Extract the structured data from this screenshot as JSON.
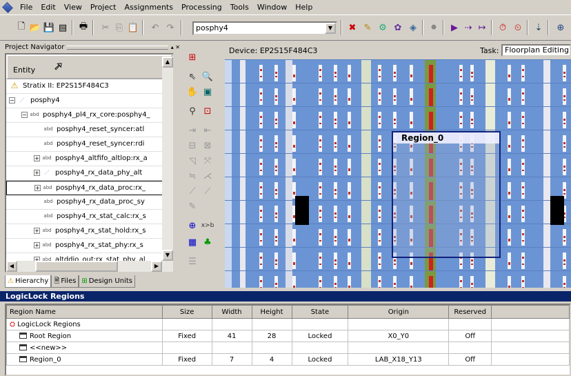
{
  "menu": [
    "File",
    "Edit",
    "View",
    "Project",
    "Assignments",
    "Processing",
    "Tools",
    "Window",
    "Help"
  ],
  "toolbar": {
    "combo_value": "posphy4"
  },
  "navigator": {
    "title": "Project Navigator",
    "column": "Entity",
    "items": [
      {
        "label": "Stratix II: EP2S15F484C3"
      },
      {
        "label": "posphy4"
      },
      {
        "label": "posphy4_pl4_rx_core:posphy4_"
      },
      {
        "label": "posphy4_reset_syncer:atl"
      },
      {
        "label": "posphy4_reset_syncer:rdi"
      },
      {
        "label": "posphy4_altfifo_altlop:rx_a"
      },
      {
        "label": "posphy4_rx_data_phy_alt"
      },
      {
        "label": "posphy4_rx_data_proc:rx_"
      },
      {
        "label": "posphy4_rx_data_proc_sy"
      },
      {
        "label": "posphy4_rx_stat_calc:rx_s"
      },
      {
        "label": "posphy4_rx_stat_hold:rx_s"
      },
      {
        "label": "posphy4_rx_stat_phy:rx_s"
      },
      {
        "label": "altddio_out:rx_stat_phy_al"
      }
    ],
    "tabs": [
      "Hierarchy",
      "Files",
      "Design Units"
    ]
  },
  "floorplan": {
    "device_label": "Device: EP2S15F484C3",
    "task_label": "Task:",
    "task_value": "Floorplan Editing (As",
    "region_label": "Region_0"
  },
  "logiclock": {
    "title": "LogicLock Regions",
    "columns": [
      "Region Name",
      "Size",
      "Width",
      "Height",
      "State",
      "Origin",
      "Reserved"
    ],
    "rows": [
      [
        "LogicLock Regions",
        "",
        "",
        "",
        "",
        "",
        ""
      ],
      [
        "Root Region",
        "Fixed",
        "41",
        "28",
        "Locked",
        "X0_Y0",
        "Off"
      ],
      [
        "<<new>>",
        "",
        "",
        "",
        "",
        "",
        ""
      ],
      [
        "Region_0",
        "Fixed",
        "7",
        "4",
        "Locked",
        "LAB_X18_Y13",
        "Off"
      ]
    ]
  }
}
